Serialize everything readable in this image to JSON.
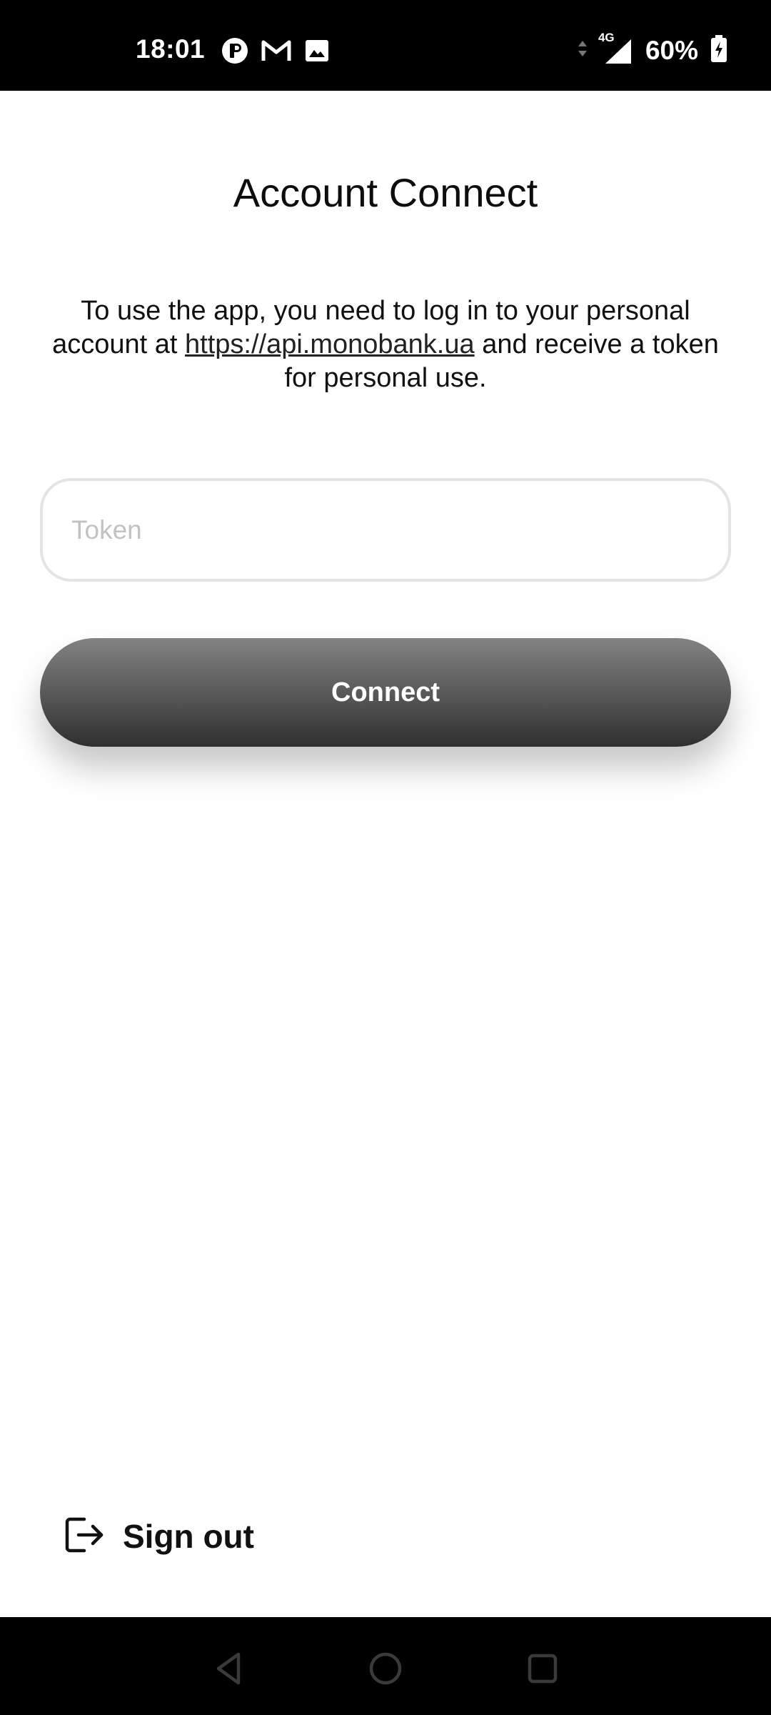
{
  "status_bar": {
    "time": "18:01",
    "battery": "60%",
    "network": "4G",
    "left_icons": [
      "app-notification-icon",
      "gmail-icon",
      "image-icon"
    ],
    "right_icons": [
      "data-arrows-icon",
      "signal-icon",
      "battery-charging-icon"
    ]
  },
  "header": {
    "title": "Account Connect"
  },
  "instructions": {
    "prefix": "To use the app, you need to log in to your personal account at ",
    "link": "https://api.monobank.ua",
    "suffix": " and receive a token for personal use."
  },
  "token_input": {
    "placeholder": "Token",
    "value": ""
  },
  "connect_button": {
    "label": "Connect"
  },
  "sign_out": {
    "label": "Sign out",
    "icon": "logout-icon"
  },
  "nav_bar": {
    "icons": [
      "back-icon",
      "home-icon",
      "recents-icon"
    ]
  },
  "colors": {
    "status_bar_bg": "#000000",
    "button_gradient_top": "#828282",
    "button_gradient_bottom": "#2f2f2f",
    "input_border": "#e4e4e4",
    "placeholder": "#c2c2c2"
  }
}
